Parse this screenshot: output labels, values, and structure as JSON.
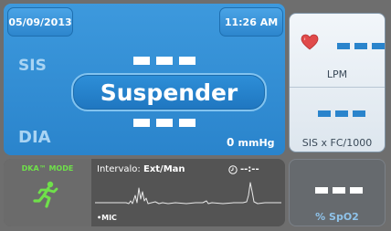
{
  "header": {
    "date": "05/09/2013",
    "time": "11:26 AM"
  },
  "nibp": {
    "sis_label": "SIS",
    "dia_label": "DIA",
    "suspend_label": "Suspender",
    "pressure_value": "0",
    "pressure_unit": "mmHg"
  },
  "vitals": {
    "heart_rate_unit": "LPM",
    "sis_fc_label": "SIS x FC/1000"
  },
  "dka": {
    "mode_label": "DKA™ MODE",
    "interval_prefix": "Intervalo:",
    "interval_value": "Ext/Man",
    "timer_value": "--:--",
    "mic_label": "•MIC"
  },
  "spo2": {
    "label": "% SpO2"
  },
  "colors": {
    "panel_blue": "#2a84cc",
    "dka_green": "#6fe04a",
    "heart_red": "#e04a4a"
  },
  "icons": {
    "heart": "heart-icon",
    "runner": "runner-icon",
    "clock": "clock-icon"
  }
}
